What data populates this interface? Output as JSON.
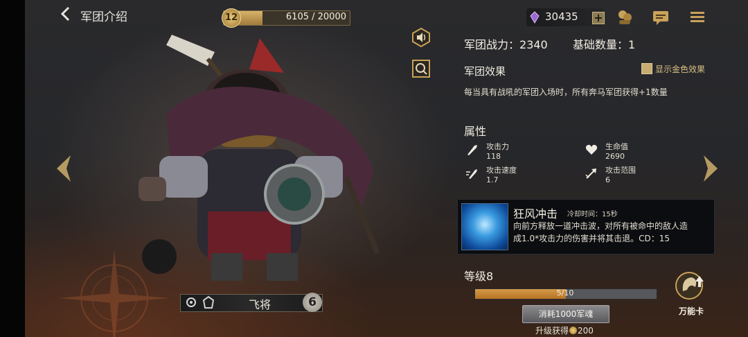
{
  "header": {
    "title": "军团介绍",
    "level": "12",
    "exp_text": "6105 / 20000",
    "exp_progress": 0.305,
    "gems": "30435"
  },
  "hero": {
    "name": "飞将",
    "count": "6"
  },
  "stats": {
    "power_label": "军团战力：",
    "power_value": "2340",
    "base_label": "基础数量：",
    "base_value": "1"
  },
  "effect": {
    "title": "军团效果",
    "toggle_label": "显示金色效果",
    "description": "每当具有战吼的军团入场时，所有奔马军团获得+1数量"
  },
  "attributes": {
    "title": "属性",
    "items": [
      {
        "label": "攻击力",
        "value": "118",
        "icon": "attack-icon"
      },
      {
        "label": "生命值",
        "value": "2690",
        "icon": "heart-icon"
      },
      {
        "label": "攻击速度",
        "value": "1.7",
        "icon": "attack-speed-icon"
      },
      {
        "label": "攻击范围",
        "value": "6",
        "icon": "attack-range-icon"
      }
    ]
  },
  "skill": {
    "name": "狂风冲击",
    "cooldown": "冷却时间：15秒",
    "line1": "向前方释放一道冲击波，对所有被命中的敌人造",
    "line2": "成1.0*攻击力的伤害并将其击退。CD：15"
  },
  "level": {
    "title": "等级8",
    "progress_text": "5/10",
    "progress": 0.5,
    "cost_button": "消耗1000军魂",
    "reward_prefix": "升级获得",
    "reward_amount": "200"
  },
  "wildcard": {
    "label": "万能卡"
  },
  "colors": {
    "gold": "#c7ad72",
    "xp": "#c98a3a",
    "skill_blue": "#3a9be0"
  }
}
